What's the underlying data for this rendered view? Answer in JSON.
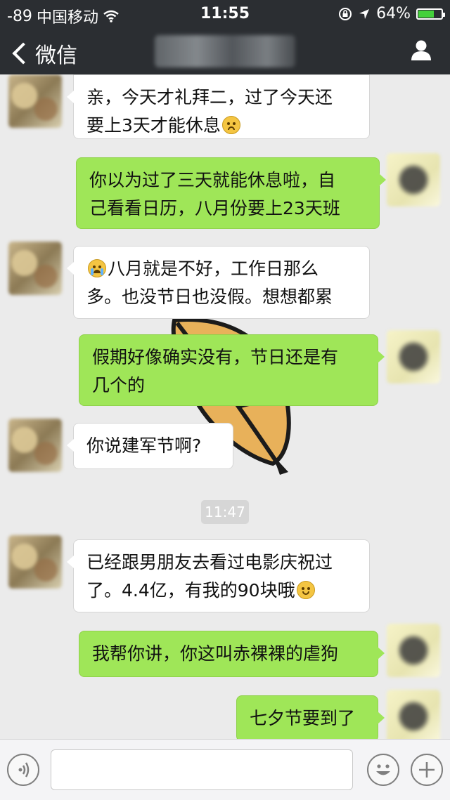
{
  "status_bar": {
    "signal": "-89",
    "carrier": "中国移动",
    "time": "11:55",
    "battery": "64%",
    "battery_level": 0.64
  },
  "nav": {
    "back_label": "微信",
    "title": ""
  },
  "messages": [
    {
      "from": "contact",
      "lines": [
        "亲，今天才礼拜二，过了今天还",
        "要上3天才能休息"
      ],
      "emoji_end": "sad-face"
    },
    {
      "from": "me",
      "lines": [
        "你以为过了三天就能休息啦，自",
        "己看看日历，八月份要上23天班"
      ]
    },
    {
      "from": "contact",
      "lines": [
        "八月就是不好，工作日那么",
        "多。也没节日也没假。想想都累"
      ],
      "emoji_start": "crying-face"
    },
    {
      "from": "me",
      "lines": [
        "假期好像确实没有，节日还是有",
        "几个的"
      ]
    },
    {
      "from": "contact",
      "lines": [
        "你说建军节啊?"
      ]
    },
    {
      "from": "contact",
      "lines": [
        "已经跟男朋友去看过电影庆祝过",
        "了。4.4亿，有我的90块哦"
      ],
      "emoji_end": "smiling-face"
    },
    {
      "from": "me",
      "lines": [
        "我帮你讲，你这叫赤裸裸的虐狗"
      ]
    },
    {
      "from": "me",
      "lines": [
        "七夕节要到了"
      ]
    }
  ],
  "timestamp": "11:47",
  "input_bar": {
    "voice_icon": "voice-wave-icon",
    "emoji_icon": "smiley-icon",
    "plus_icon": "plus-icon"
  },
  "colors": {
    "bar_bg": "#2b2e32",
    "chat_bg": "#ebebeb",
    "out_bubble": "#9fe658",
    "in_bubble": "#ffffff"
  }
}
